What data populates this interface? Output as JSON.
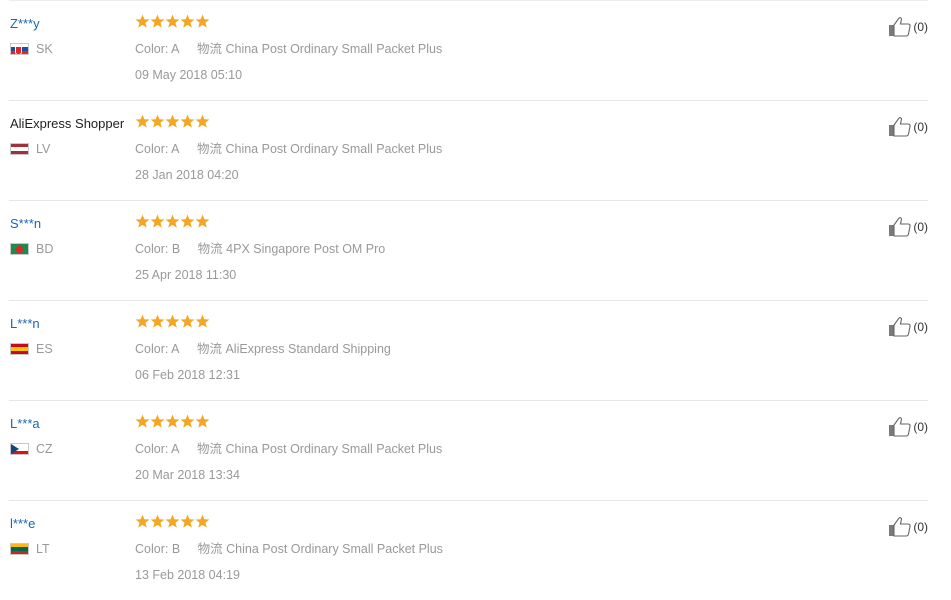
{
  "labels": {
    "color": "Color:",
    "logistics": "物流"
  },
  "colors": {
    "star": "#f5a623",
    "user_link": "#1a66b3",
    "muted": "#999999"
  },
  "rating_max": 5,
  "reviews": [
    {
      "user": "Z***y",
      "country": "SK",
      "rating": 5,
      "color_value": "A",
      "shipping": "China Post Ordinary Small Packet Plus",
      "date": "09 May 2018 05:10",
      "likes": "(0)",
      "flag": [
        "#ffffff",
        "#1d4fa0",
        "#e3242b"
      ]
    },
    {
      "user": "AliExpress Shopper",
      "country": "LV",
      "rating": 5,
      "color_value": "A",
      "shipping": "China Post Ordinary Small Packet Plus",
      "date": "28 Jan 2018 04:20",
      "likes": "(0)",
      "flag": [
        "#a2323a",
        "#ffffff",
        "#a2323a"
      ]
    },
    {
      "user": "S***n",
      "country": "BD",
      "rating": 5,
      "color_value": "B",
      "shipping": "4PX Singapore Post OM Pro",
      "date": "25 Apr 2018 11:30",
      "likes": "(0)",
      "flag": [
        "#1f8a4c",
        "#1f8a4c",
        "#1f8a4c"
      ]
    },
    {
      "user": "L***n",
      "country": "ES",
      "rating": 5,
      "color_value": "A",
      "shipping": "AliExpress Standard Shipping",
      "date": "06 Feb 2018 12:31",
      "likes": "(0)",
      "flag": [
        "#c60b1e",
        "#ffc400",
        "#c60b1e"
      ]
    },
    {
      "user": "L***a",
      "country": "CZ",
      "rating": 5,
      "color_value": "A",
      "shipping": "China Post Ordinary Small Packet Plus",
      "date": "20 Mar 2018 13:34",
      "likes": "(0)",
      "flag": [
        "#ffffff",
        "#d7141a",
        "#11457e"
      ]
    },
    {
      "user": "l***e",
      "country": "LT",
      "rating": 5,
      "color_value": "B",
      "shipping": "China Post Ordinary Small Packet Plus",
      "date": "13 Feb 2018 04:19",
      "likes": "(0)",
      "flag": [
        "#fdb913",
        "#006a44",
        "#c1272d"
      ]
    }
  ]
}
